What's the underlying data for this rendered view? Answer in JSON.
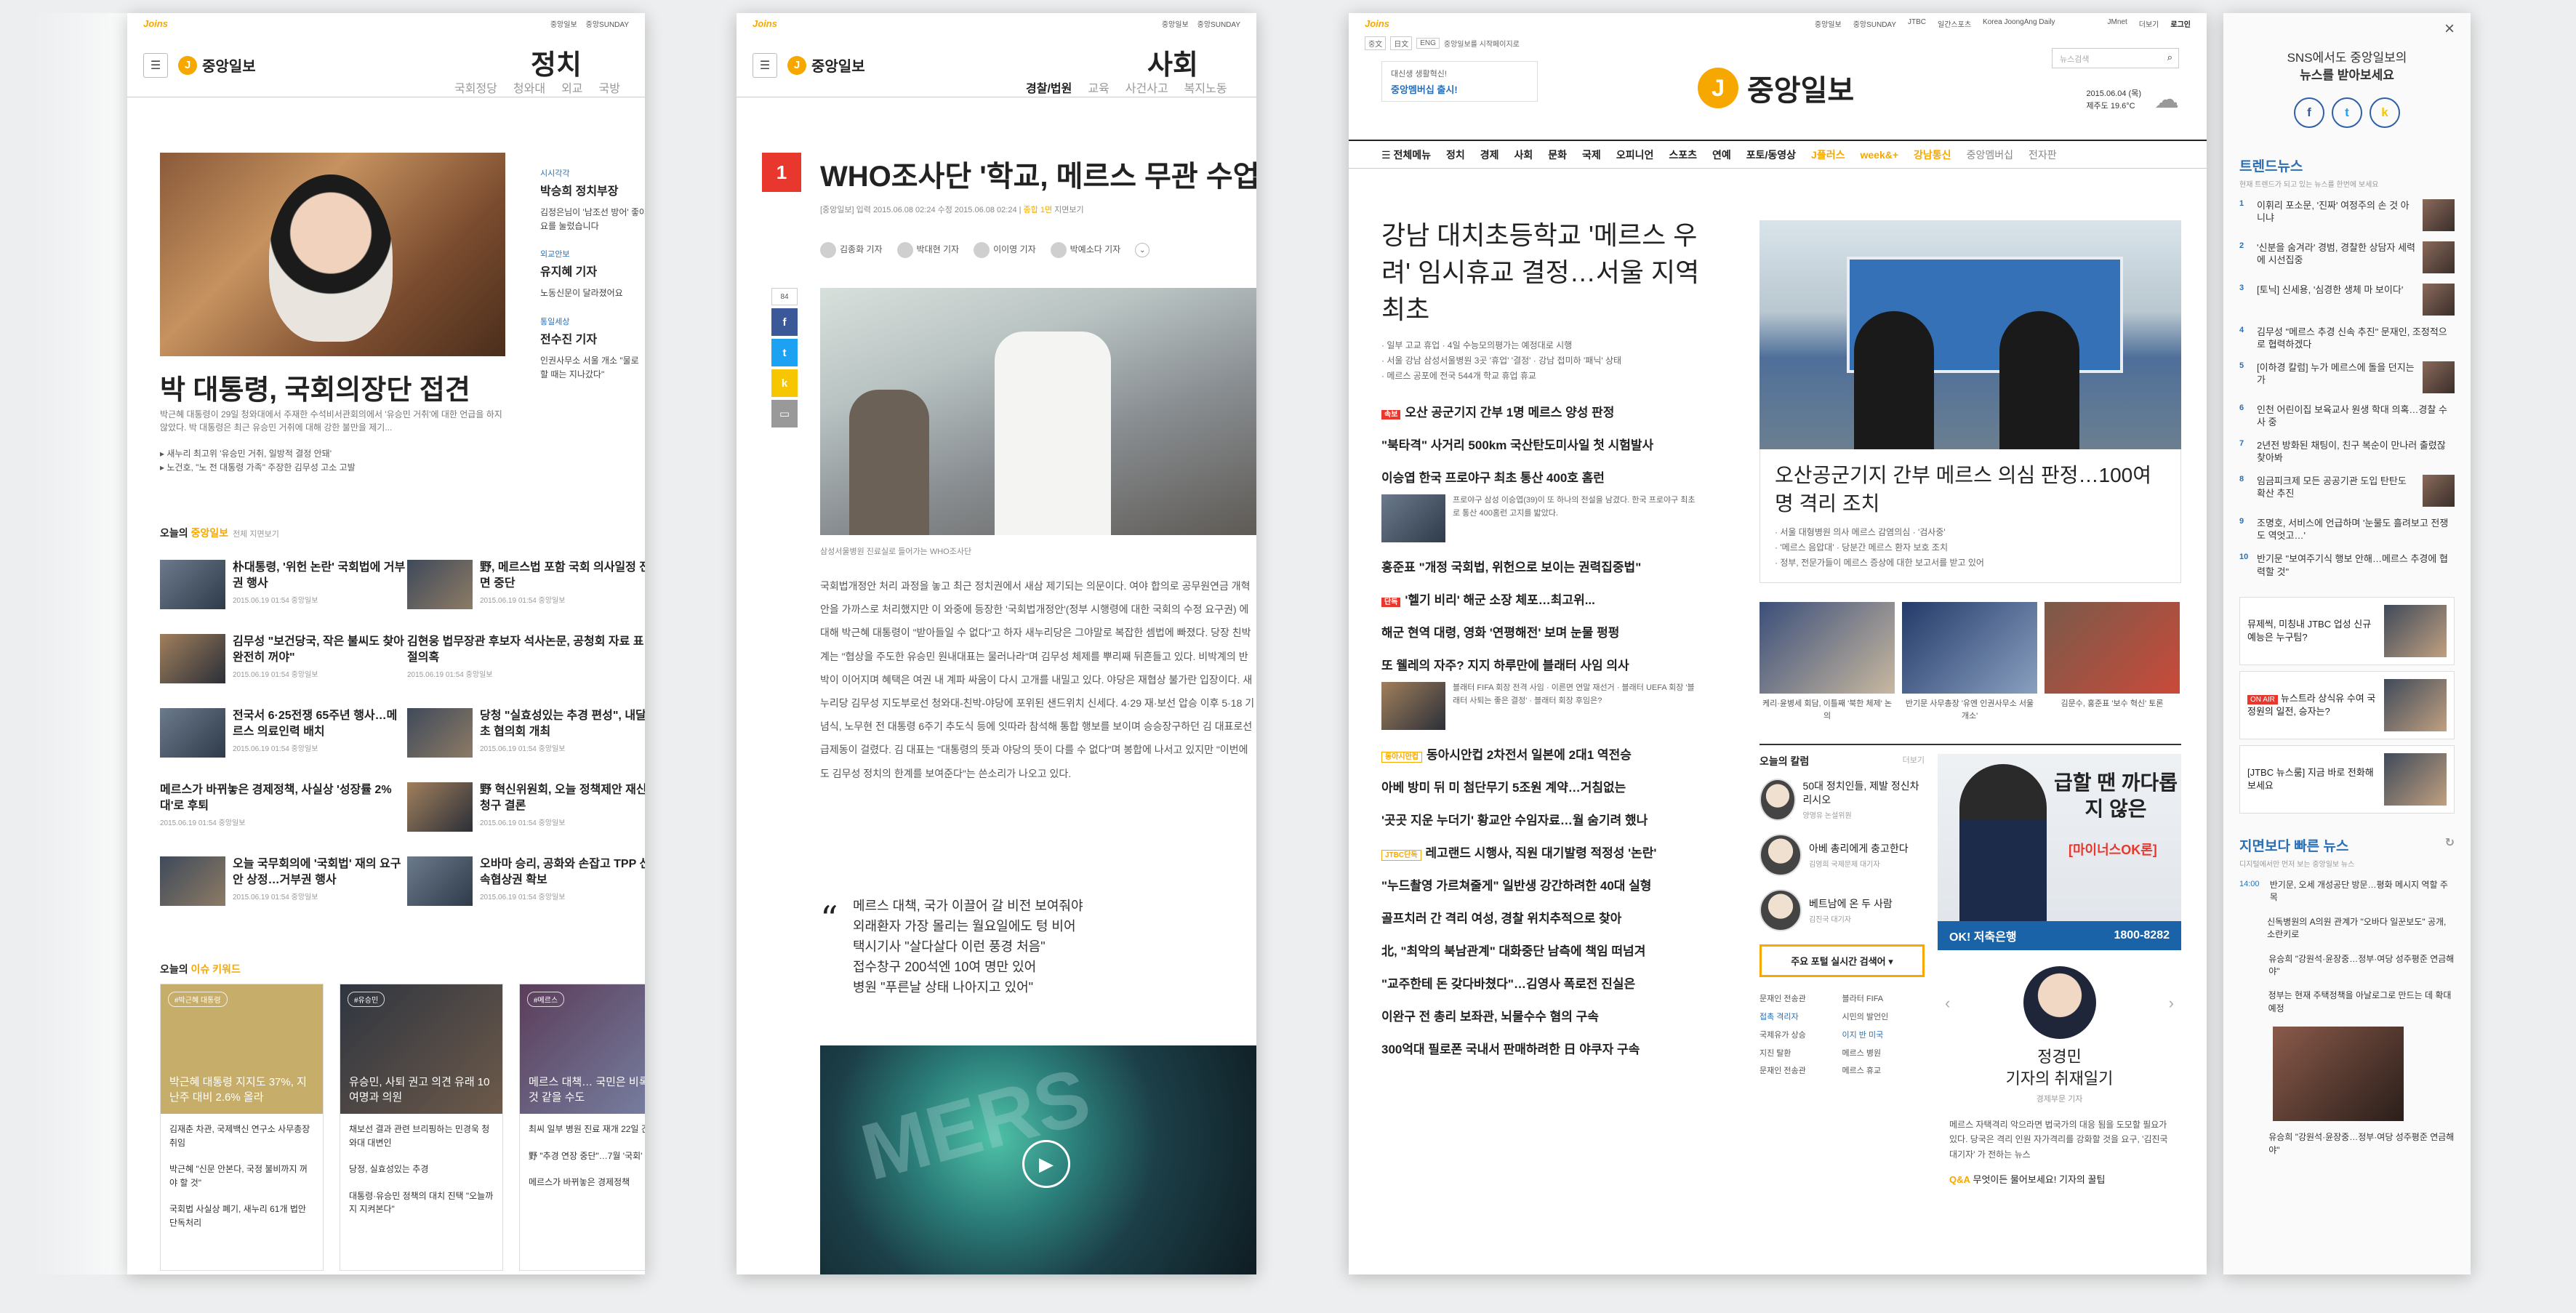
{
  "politics": {
    "joins": "Joins",
    "top_links": [
      "중앙일보",
      "중앙SUNDAY"
    ],
    "brand": "중앙일보",
    "section_title": "정치",
    "sub_nav": [
      "국회정당",
      "청와대",
      "외교",
      "국방"
    ],
    "hero_title": "박 대통령, 국회의장단 접견",
    "hero_desc": "박근혜 대통령이 29일 청와대에서 주재한 수석비서관회의에서 '유승민 거취'에 대한 언급을 하지 않았다. 박 대통령은 최근 유승민 거취에 대해 강한 불만을 제기...",
    "hero_related": [
      "새누리 최고위 '유승민 거취, 일방적 결정 안돼'",
      "노건호, \"노 전 대통령 가족\" 주장한 김무성 고소 고발"
    ],
    "side_blocks": [
      {
        "cat": "시시각각",
        "head": "박승희 정치부장",
        "text": "김정은님이 '남조선 방어' 좋아요를 눌렀습니다"
      },
      {
        "cat": "외교안보",
        "head": "유지혜 기자",
        "text": "노동신문이 달라졌어요"
      },
      {
        "cat": "통일세상",
        "head": "전수진 기자",
        "text": "인권사무소 서울 개소 \"물로 할 때는 지나갔다\""
      }
    ],
    "today_label_prefix": "오늘의",
    "today_label_brand": "중앙일보",
    "today_label_sub": "전체 지면보기",
    "today_items": [
      {
        "title": "朴대통령, '위헌 논란' 국회법에 거부권 행사",
        "date": "2015.06.19  01:54  중앙일보"
      },
      {
        "title": "野, 메르스법 포함 국회 의사일정 전면 중단",
        "date": "2015.06.19  01:54  중앙일보"
      },
      {
        "title": "김무성 \"보건당국, 작은 불씨도 찾아 완전히 꺼야\"",
        "date": "2015.06.19  01:54  중앙일보"
      },
      {
        "title": "김현웅 법무장관 후보자 석사논문, 공청회 자료 표절의혹",
        "date": "2015.06.19  01:54  중앙일보"
      },
      {
        "title": "전국서 6·25전쟁 65주년 행사…메르스 의료인력 배치",
        "date": "2015.06.19  01:54  중앙일보"
      },
      {
        "title": "당청 \"실효성있는 추경 편성\", 내달초 협의회 개최",
        "date": "2015.06.19  01:54  중앙일보"
      },
      {
        "title": "메르스가 바뀌놓은 경제정책, 사실상 '성장률 2%대'로 후퇴",
        "date": "2015.06.19  01:54  중앙일보"
      },
      {
        "title": "野 혁신위원회, 오늘 정책제안 재신청구 결론",
        "date": "2015.06.19  01:54  중앙일보"
      },
      {
        "title": "오늘 국무회의에 '국회법' 재의 요구안 상정…거부권 행사",
        "date": "2015.06.19  01:54  중앙일보"
      },
      {
        "title": "오바마 승리, 공화와 손잡고 TPP 신속협상권 확보",
        "date": "2015.06.19  01:54  중앙일보"
      }
    ],
    "keyword_prefix": "오늘의",
    "keyword_label": "이슈 키워드",
    "keyword_cards": [
      {
        "tag": "#박근혜 대통령",
        "title": "박근혜 대통령 지지도 37%, 지난주 대비 2.6% 올라",
        "list": [
          "김재춘 차관, 국제백신 연구소 사무총장 취임",
          "박근혜 \"신문 안본다, 국정 불비까지 꺼야 할 것\"",
          "국회법 사실상 폐기, 새누리 61개 법안 단독처리"
        ]
      },
      {
        "tag": "#유승민",
        "title": "유승민, 사퇴 권고 의견 유래 10여명과 의원",
        "list": [
          "채보선 결과 관련 브리핑하는 민경욱 청와대 대변인",
          "당정, 실효성있는 추경",
          "대통령·유승민 정책의 대치 진택 \"오늘까지 지켜본다\""
        ]
      },
      {
        "tag": "#메르스",
        "title": "메르스 대책… 국민은 비록 이런 것 같을 수도",
        "list": [
          "최씨 일부 병원 진료 재개 22일 긴급회의",
          "野 \"추경 연장 중단\"…7월 '국회' 협의",
          "메르스가 바뀌놓은 경제정책"
        ]
      }
    ]
  },
  "society": {
    "joins": "Joins",
    "top_links": [
      "중앙일보",
      "중앙SUNDAY"
    ],
    "brand": "중앙일보",
    "section_title": "사회",
    "sub_nav": [
      "경찰/법원",
      "교육",
      "사건사고",
      "복지노동"
    ],
    "rank": "1",
    "title": "WHO조사단 '학교, 메르스 무관 수업가능'",
    "meta_prefix": "[중앙일보] 입력 2015.06.08 02:24  수정 2015.06.08 02:24 |",
    "meta_paper": "종합 1면",
    "meta_suffix": "지면보기",
    "reporters": [
      "김종화 기자",
      "박대현 기자",
      "이이영 기자",
      "박예소다 기자"
    ],
    "share_count": "84",
    "photo_caption": "삼성서울병원 진료실로 들어가는 WHO조사단",
    "body": "국회법개정안 처리 과정을 놓고 최근 정치권에서 새삼 제기되는 의문이다. 여야 합의로 공무원연금 개혁 안을 가까스로 처리했지만 이 와중에 등장한 '국회법개정안'(정부 시행령에 대한 국회의 수정 요구권) 에 대해 박근혜 대통령이 \"받아들일 수 없다\"고 하자 새누리당은 그야말로 복잡한 셈법에 빠졌다. 당장 친박계는 \"협상을 주도한 유승민 원내대표는 물러나라\"며 김무성 체제를 뿌리째 뒤흔들고 있다. 비박계의 반박이 이어지며 혜택은 여권 내 계파 싸움이 다시 고개를 내밀고 있다. 야당은 재협상 불가란 입장이다. 새누리당 김무성 지도부로선 청와대-친박-야당에 포위된 샌드위치 신세다. 4·29 재·보선 압승 이후 5·18 기념식, 노무현 전 대통령 6주기 추도식 등에 잇따라 참석해 통합 행보를 보이며 승승장구하던 김 대표로선 급제동이 걸렸다. 김 대표는 \"대통령의 뜻과 야당의 뜻이 다를 수 없다\"며 봉합에 나서고 있지만 \"이번에도 김무성 정치의 한계를 보여준다\"는 쓴소리가 나오고 있다.",
    "quote": [
      "메르스 대책, 국가 이끌어 갈 비전 보여줘야",
      "외래환자 가장 몰리는 월요일에도 텅 비어",
      "택시기사 \"살다살다 이런 풍경 처음\"",
      "접수창구 200석엔 10여 명만 있어",
      "병원 \"푸른날 상태 나아지고 있어\""
    ],
    "video_text": "MERS"
  },
  "main": {
    "joins": "Joins",
    "top_links": [
      "중앙일보",
      "중앙SUNDAY",
      "JTBC",
      "일간스포츠",
      "Korea JoongAng Daily"
    ],
    "top_right": [
      "JMnet",
      "더보기",
      "로그인"
    ],
    "lang_badges": [
      "중文",
      "日文",
      "ENG"
    ],
    "homepage_label": "중앙일보를 시작페이지로",
    "ad_line1": "대신생 생활혁신!",
    "ad_line2": "중앙멤버십 출시!",
    "brand": "중앙일보",
    "search_placeholder": "뉴스검색",
    "weather_date": "2015.06.04 (목)",
    "weather_temp": "제주도 19.6°C",
    "nav": [
      "전체메뉴",
      "정치",
      "경제",
      "사회",
      "문화",
      "국제",
      "오피니언",
      "스포츠",
      "연예",
      "포토/동영상",
      "J플러스",
      "week&+",
      "강남통신",
      "중앙멤버십",
      "전자판"
    ],
    "lead_title": "강남 대치초등학교 '메르스 우려' 임시휴교 결정…서울 지역 최초",
    "lead_related": [
      "일부 고교 휴업 · 4일 수능모의평가는 예정대로 시행",
      "서울 강남 삼성서울병원 3곳 '휴업' '결정' · 강남 접미하 '패닉' 상태",
      "메르스 공포에 전국 544개 학교 휴업 휴교"
    ],
    "headlines": [
      {
        "tag": "속보",
        "title": "오산 공군기지 간부 1명 메르스 양성 판정"
      },
      {
        "tag": "",
        "title": "\"북타격\" 사거리 500km 국산탄도미사일 첫 시험발사"
      },
      {
        "tag": "",
        "title": "이승엽 한국 프로야구 최초 통산 400호 홈런"
      },
      {
        "tag": "",
        "title": "홍준표 \"개정 국회법, 위헌으로 보이는 권력집중법\""
      },
      {
        "tag": "단독",
        "title": "'헬기 비리' 해군 소장 체포…최고위..."
      },
      {
        "tag": "",
        "title": "해군 현역 대령, 영화 '연평해전' 보며 눈물 펑펑"
      },
      {
        "tag": "",
        "title": "또 웰레의 자주? 지지 하루만에 블래터 사임 의사"
      },
      {
        "tag": "동아시안컵",
        "title": "동아시안컵 2차전서 일본에 2대1 역전승"
      },
      {
        "tag": "",
        "title": "아베 방미 뒤 미 첨단무기 5조원 계약…거침없는"
      },
      {
        "tag": "",
        "title": "'곳곳 지운 누더기' 황교안 수임자료…월 숨기려 했나"
      },
      {
        "tag": "JTBC단독",
        "title": "레고랜드 시행사, 직원 대기발령 적정성 '논란'"
      },
      {
        "tag": "",
        "title": "\"누드촬영 가르쳐줄게\" 일반생 강간하려한 40대 실형"
      },
      {
        "tag": "",
        "title": "골프치러 간 격리 여성, 경찰 위치추적으로 찾아"
      },
      {
        "tag": "",
        "title": "北, \"최악의 북남관계\" 대화중단 남측에 책임 떠넘겨"
      },
      {
        "tag": "",
        "title": "\"교주한테 돈 갖다바쳤다\"…김영사 폭로전 진실은"
      },
      {
        "tag": "",
        "title": "이완구 전 총리 보좌관, 뇌물수수 혐의 구속"
      },
      {
        "tag": "",
        "title": "300억대 필로폰 국내서 판매하려한 日 야쿠자 구속"
      }
    ],
    "hl_image_text": "프로야구 삼성 이승엽(39)이 또 하나의 전설을 남겼다. 한국 프로야구 최초로 통산 400홈런 고지를 밟았다.",
    "blatter_text": "블래터 FIFA 회장 전격 사임 · 이른면 연말 재선거 · 블래터 UEFA 회장 '블래터 사퇴는 좋은 결정' · 블래터 회장 후임은?",
    "main_photo_title": "오산공군기지 간부 메르스 의심 판정…100여명 격리 조치",
    "main_photo_related": [
      "서울 대형병원 의사 메르스 감염의심 · '검사중'",
      "'메르스 음압대' · 당분간 메르스 환자 보호 조치",
      "정부, 전문가들이 메르스 증상에 대한 보고서를 받고 있어"
    ],
    "triple": [
      {
        "caption": "케리·윤병세 회담, 이틀째 '북한 체제' 논의"
      },
      {
        "caption": "반기문 사무총장 '유엔 인권사무소 서울 개소'"
      },
      {
        "caption": "김문수, 홍준표 '보수 혁신' 토론"
      }
    ],
    "column_head": "오늘의 칼럼",
    "column_more": "더보기",
    "columns": [
      {
        "title": "50대 정치인들, 제발 정신차리시오",
        "sub": "양영유 논설위원"
      },
      {
        "title": "아베 총리에게 충고한다",
        "sub": "김영희 국제문제 대기자"
      },
      {
        "title": "베트남에 온 두 사람",
        "sub": "김진국 대기자"
      }
    ],
    "realtime_search": "주요 포털 실시간 검색어",
    "keywords": [
      "문재인 전송관",
      "블라터 FIFA",
      "접촉 격리자",
      "시민의 발언인",
      "국제유가 상승",
      "이지 반 미국",
      "지진 탈환",
      "메르스 병원",
      "문재인 전송관",
      "메르스 휴교"
    ],
    "ad_copy": "급할 땐 까다롭지 않은",
    "ad_copy2": "[마이너스OK론]",
    "ad_brand": "OK! 저축은행",
    "ad_phone": "1800-8282",
    "reporter_name": "정경민",
    "reporter_title": "기자의 취재일기",
    "reporter_dept": "경제부문 기자",
    "reporter_text": "메르스 자택격리 악으라면 법국가의 대응 됨을 도모할 필요가 있다. 당국은 격리 인원 자가격리를 강화할 것을 요구, '김진국 대기자' 가 전하는 뉴스",
    "qa_prefix": "Q&A",
    "qa_text": "무엇이든 물어보세요! 기자의 꿀팁"
  },
  "side": {
    "sns_line1": "SNS에서도 중앙일보의",
    "sns_line2": "뉴스를 받아보세요",
    "sns_icons": [
      "f",
      "t",
      "k"
    ],
    "trend_head": "트렌드뉴스",
    "trend_sub": "현재 트렌드가 되고 있는 뉴스를 한번에 보세요",
    "trends": [
      "이휘리 포소문, '진짜' 여정주의 손 것 아니냐",
      "'신분을 숨겨라' 경범, 경찰한 상담자 세력에 시선집중",
      "[토닉] 신세용, '심경한 생체 마 보이다'",
      "김무성 \"메르스 추경 신속 추진\" 문재인, 조정적으로 협력하겠다",
      "[이하경 칼럼] 누가 메르스에 돌을 던지는가",
      "인천 어린이집 보육교사 원생 학대 의혹…경찰 수사 중",
      "2년전 방화된 채팅이, 친구 복순이 만나러 출렸잖 찾아봐",
      "임금피크제 모든 공공기관 도입 탄탄도 확산 추진",
      "조명호, 서비스에 언급하며 '눈물도 흘려보고 전쟁도 역엇고…'",
      "반기문 \"보여주기식 행보 안해…메르스 추경에 협력할 것\""
    ],
    "promo1": "뮤제씩, 미칭내 JTBC 업성 신규 예능은 누구팀?",
    "promo2_onair": "ON AIR",
    "promo2": "뉴스트라 상식유 수여 국정원의 일전, 승자는?",
    "promo3": "[JTBC 뉴스룸] 지금 바로 전화해보세요",
    "fast_head": "지면보다 빠른 뉴스",
    "fast_sub": "디지털에서만 먼저 보는 중앙일보 뉴스",
    "fast": [
      {
        "time": "14:00",
        "text": "반기문, 오세 개성공단 방문…평화 메시지 역할 주목"
      },
      {
        "time": "",
        "text": "신독병원의 A의원 관계가 \"오바다 일꾼보도\" 공개, 소란키로"
      },
      {
        "time": "",
        "text": "유승희 \"강원석·윤장중…정부·여당 성주평준 연금해야\""
      },
      {
        "time": "",
        "text": "정부는 현재 주택정책을 아날로그로 만드는 데 확대 예정"
      },
      {
        "time": "",
        "text": "유승희 \"강원석·윤장중…정부·여당 성주평준 연금해야\""
      }
    ]
  }
}
